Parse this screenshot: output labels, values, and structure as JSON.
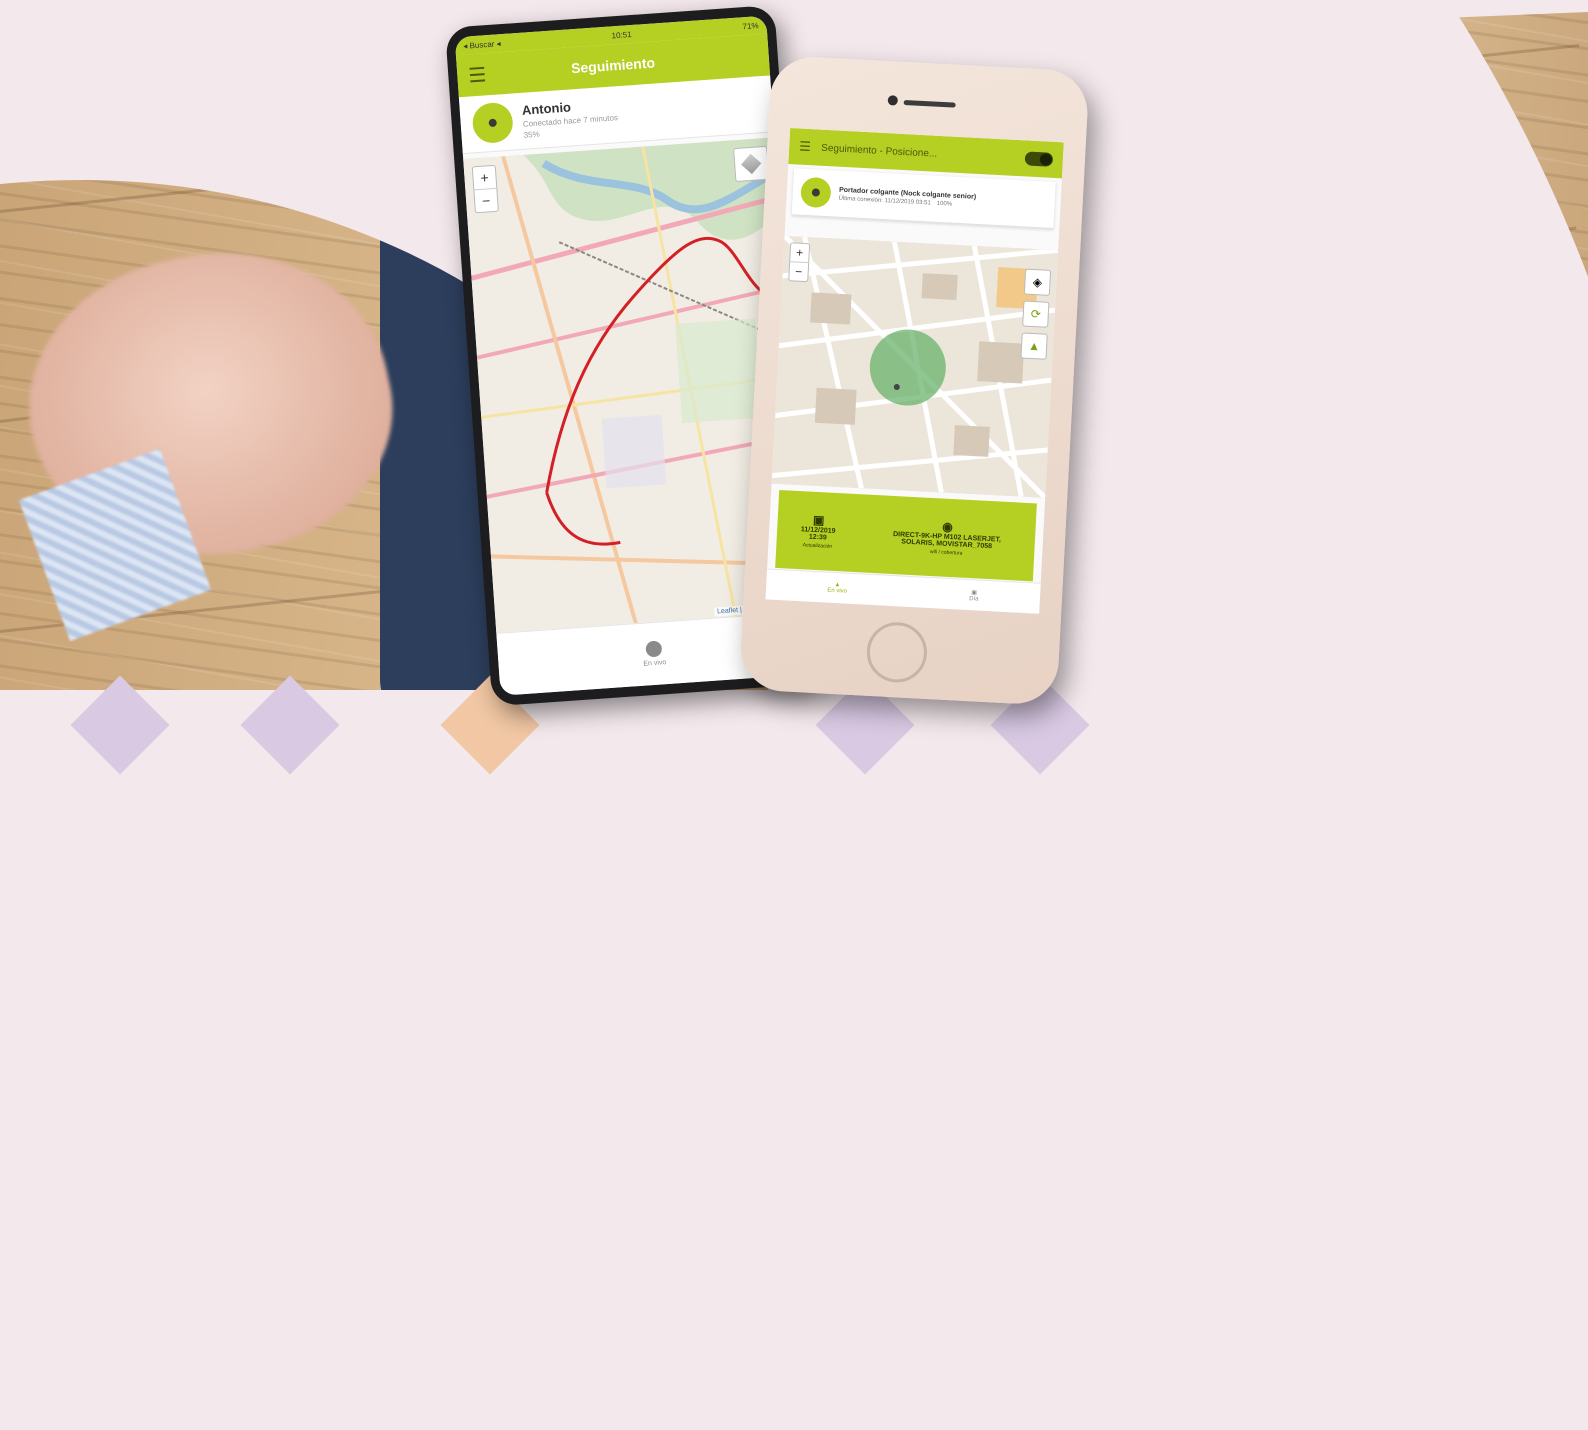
{
  "colors": {
    "accent": "#b5cf22",
    "background": "#f3e8ec",
    "route": "#d32027",
    "geofence": "#6ab36c"
  },
  "android_phone": {
    "status_left": "◂ Buscar ◂",
    "status_time": "10:51",
    "status_right": "71%",
    "appbar_title": "Seguimiento",
    "menu_icon": "menu-icon",
    "user": {
      "name": "Antonio",
      "subtitle": "Conectado hace 7 minutos",
      "battery": "35%"
    },
    "map": {
      "zoom_in": "+",
      "zoom_out": "−",
      "attribution": "Leaflet | © OpenStreetMap"
    },
    "bottom_nav": {
      "label": "En vivo"
    }
  },
  "iphone": {
    "appbar_title": "Seguimiento - Posicione...",
    "device": {
      "name": "Portador colgante (Nock colgante senior)",
      "last_connection": "Última conexión: 11/12/2019 03:51",
      "battery": "100%"
    },
    "map": {
      "zoom_in": "+",
      "zoom_out": "−"
    },
    "info_panel": {
      "date": "11/12/2019",
      "time": "12:39",
      "left_caption": "Actualización",
      "location_line1": "DIRECT-9K-HP M102 LASERJET,",
      "location_line2": "SOLARIS, MOVISTAR_7058",
      "right_caption": "wifi / cobertura"
    },
    "tabs": [
      {
        "label": "En vivo",
        "icon": "pin-icon"
      },
      {
        "label": "Día",
        "icon": "calendar-icon"
      }
    ]
  }
}
